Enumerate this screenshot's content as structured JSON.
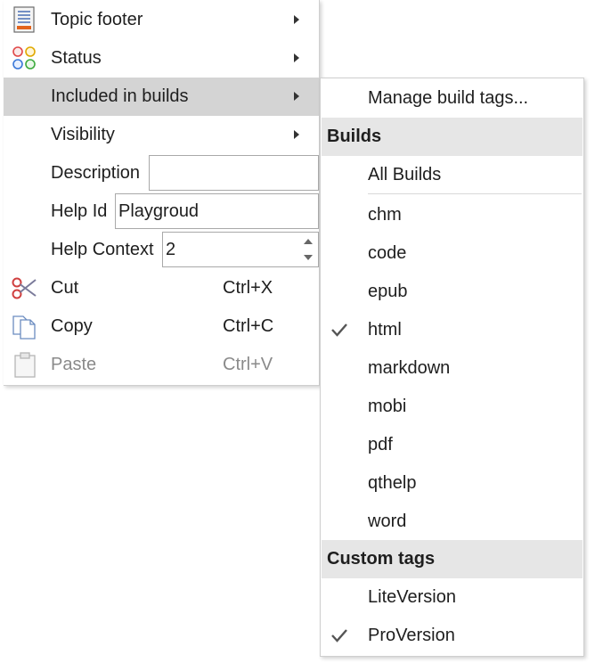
{
  "main_menu": {
    "topic_footer": "Topic footer",
    "status": "Status",
    "included_in_builds": "Included in builds",
    "visibility": "Visibility",
    "description_label": "Description",
    "description_value": "",
    "help_id_label": "Help Id",
    "help_id_value": "Playgroud",
    "help_context_label": "Help Context",
    "help_context_value": "2",
    "cut_label": "Cut",
    "cut_shortcut": "Ctrl+X",
    "copy_label": "Copy",
    "copy_shortcut": "Ctrl+C",
    "paste_label": "Paste",
    "paste_shortcut": "Ctrl+V"
  },
  "sub_menu": {
    "manage_label": "Manage build tags...",
    "builds_header": "Builds",
    "all_builds": "All Builds",
    "builds": [
      {
        "label": "chm",
        "checked": false
      },
      {
        "label": "code",
        "checked": false
      },
      {
        "label": "epub",
        "checked": false
      },
      {
        "label": "html",
        "checked": true
      },
      {
        "label": "markdown",
        "checked": false
      },
      {
        "label": "mobi",
        "checked": false
      },
      {
        "label": "pdf",
        "checked": false
      },
      {
        "label": "qthelp",
        "checked": false
      },
      {
        "label": "word",
        "checked": false
      }
    ],
    "custom_header": "Custom tags",
    "custom_tags": [
      {
        "label": "LiteVersion",
        "checked": false
      },
      {
        "label": "ProVersion",
        "checked": true
      }
    ]
  },
  "colors": {
    "highlight": "#d4d4d4",
    "header_bg": "#e6e6e6",
    "disabled_text": "#8a8a8a"
  }
}
